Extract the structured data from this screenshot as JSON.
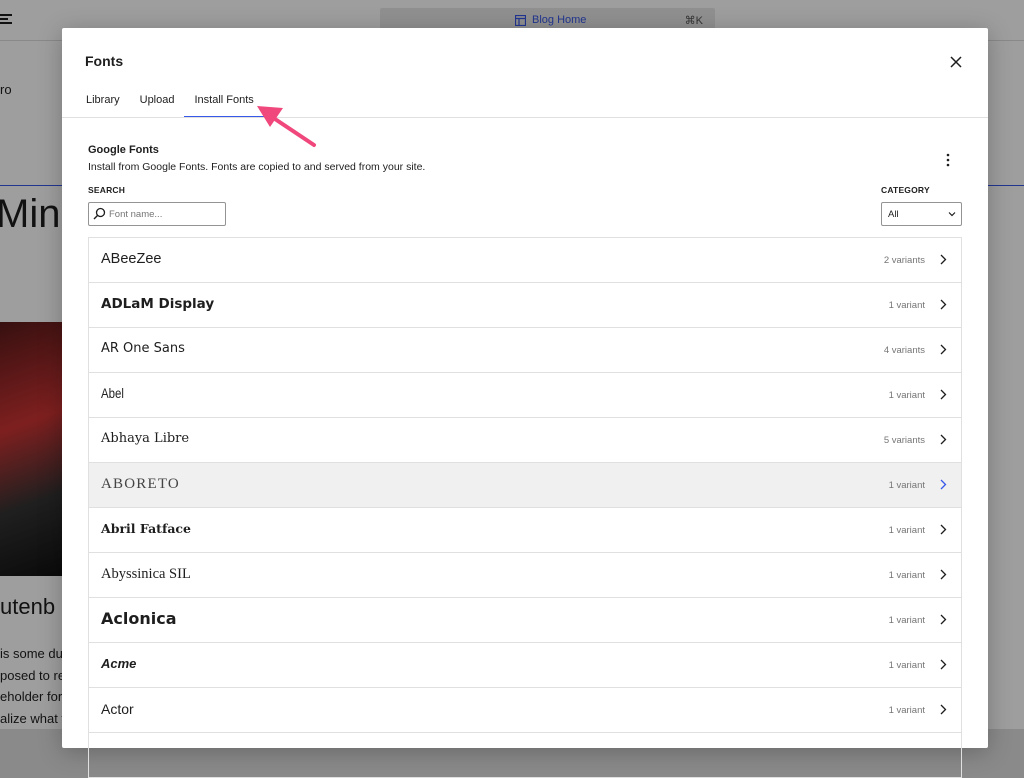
{
  "background": {
    "command_bar": {
      "title": "Blog Home",
      "shortcut": "⌘K"
    },
    "left_fragments": {
      "ro": "ro",
      "heading": "Mind",
      "subheading": "utenb",
      "text_lines": [
        "is some du",
        "posed to re",
        "eholder for",
        "alize what t"
      ]
    }
  },
  "modal": {
    "title": "Fonts",
    "tabs": [
      {
        "label": "Library",
        "active": false
      },
      {
        "label": "Upload",
        "active": false
      },
      {
        "label": "Install Fonts",
        "active": true
      }
    ],
    "section": {
      "title": "Google Fonts",
      "description": "Install from Google Fonts. Fonts are copied to and served from your site."
    },
    "search": {
      "label": "SEARCH",
      "placeholder": "Font name...",
      "value": ""
    },
    "category": {
      "label": "CATEGORY",
      "value": "All"
    },
    "fonts": [
      {
        "name": "ABeeZee",
        "variants": "2 variants"
      },
      {
        "name": "ADLaM Display",
        "variants": "1 variant"
      },
      {
        "name": "AR One Sans",
        "variants": "4 variants"
      },
      {
        "name": "Abel",
        "variants": "1 variant"
      },
      {
        "name": "Abhaya Libre",
        "variants": "5 variants"
      },
      {
        "name": "ABORETO",
        "variants": "1 variant"
      },
      {
        "name": "Abril Fatface",
        "variants": "1 variant"
      },
      {
        "name": "Abyssinica SIL",
        "variants": "1 variant"
      },
      {
        "name": "Aclonica",
        "variants": "1 variant"
      },
      {
        "name": "Acme",
        "variants": "1 variant"
      },
      {
        "name": "Actor",
        "variants": "1 variant"
      }
    ]
  },
  "colors": {
    "accent": "#3858e9",
    "annotation_arrow": "#f0477c",
    "text": "#1e1e1e",
    "muted": "#757575"
  }
}
